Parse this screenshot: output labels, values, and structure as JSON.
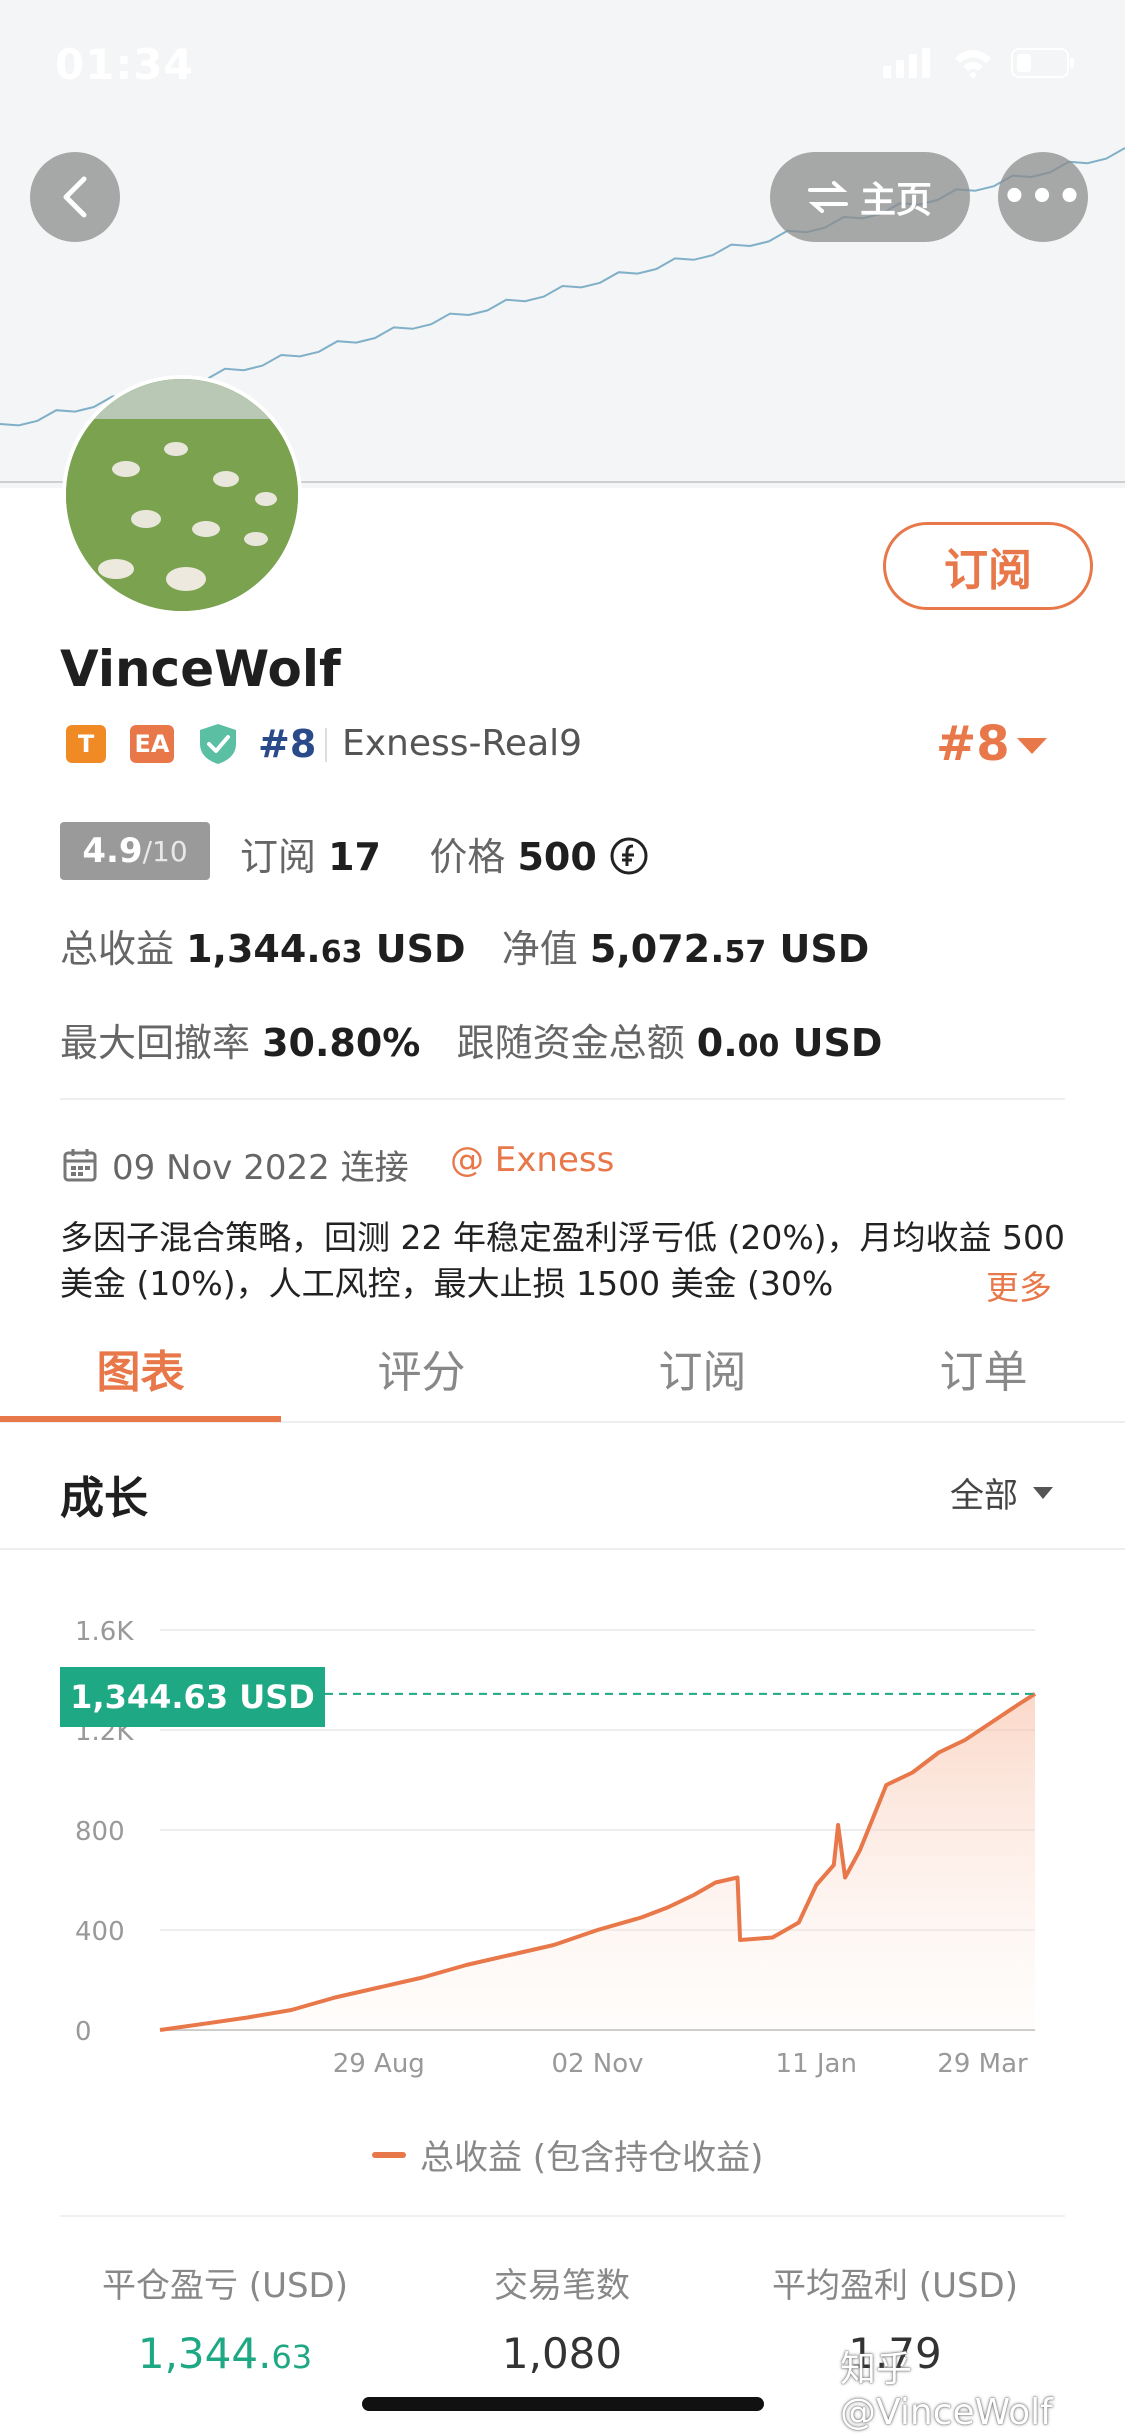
{
  "status_bar": {
    "time": "01:34"
  },
  "header": {
    "home_label": "主页",
    "more_label": "•••"
  },
  "profile": {
    "subscribe_label": "订阅",
    "username": "VinceWolf",
    "tags": {
      "t": "T",
      "ea": "EA"
    },
    "rank_small": "#8",
    "server": "Exness-Real9",
    "rank_big": "#8",
    "rating": {
      "score": "4.9",
      "denom": "/10"
    },
    "subscribers_label": "订阅",
    "subscribers_value": "17",
    "price_label": "价格",
    "price_value": "500",
    "total_profit_label": "总收益",
    "total_profit_int": "1,344.",
    "total_profit_dec": "63",
    "total_profit_unit": "USD",
    "equity_label": "净值",
    "equity_int": "5,072.",
    "equity_dec": "57",
    "equity_unit": "USD",
    "max_dd_label": "最大回撤率",
    "max_dd_value": "30.80%",
    "follow_label": "跟随资金总额",
    "follow_int": "0.",
    "follow_dec": "00",
    "follow_unit": "USD",
    "date_text": "09 Nov 2022 连接",
    "broker": "@ Exness",
    "description": "多因子混合策略，回测 22 年稳定盈利浮亏低 (20%)，月均收益 500 美金 (10%)，人工风控，最大止损 1500 美金 (30%",
    "more_label": "更多"
  },
  "tabs": [
    "图表",
    "评分",
    "订阅",
    "订单"
  ],
  "growth": {
    "title": "成长",
    "range": "全部",
    "current_label": "1,344.63 USD",
    "legend": "总收益 (包含持仓收益)"
  },
  "chart_data": {
    "type": "area",
    "title": "",
    "xlabel": "",
    "ylabel": "",
    "ylim": [
      0,
      1600
    ],
    "yticks": [
      "0",
      "400",
      "800",
      "1.2K",
      "1.6K"
    ],
    "xticks": [
      "29 Aug",
      "02 Nov",
      "11 Jan",
      "29 Mar"
    ],
    "series": [
      {
        "name": "总收益 (包含持仓收益)",
        "color": "#e8784a",
        "points": [
          [
            0,
            0
          ],
          [
            0.05,
            25
          ],
          [
            0.1,
            50
          ],
          [
            0.15,
            80
          ],
          [
            0.2,
            130
          ],
          [
            0.25,
            170
          ],
          [
            0.3,
            210
          ],
          [
            0.35,
            260
          ],
          [
            0.4,
            300
          ],
          [
            0.45,
            340
          ],
          [
            0.5,
            400
          ],
          [
            0.55,
            450
          ],
          [
            0.58,
            490
          ],
          [
            0.61,
            540
          ],
          [
            0.635,
            590
          ],
          [
            0.66,
            610
          ],
          [
            0.663,
            360
          ],
          [
            0.7,
            370
          ],
          [
            0.73,
            430
          ],
          [
            0.75,
            580
          ],
          [
            0.77,
            660
          ],
          [
            0.775,
            820
          ],
          [
            0.783,
            610
          ],
          [
            0.8,
            720
          ],
          [
            0.83,
            980
          ],
          [
            0.86,
            1030
          ],
          [
            0.89,
            1110
          ],
          [
            0.92,
            1160
          ],
          [
            0.95,
            1230
          ],
          [
            0.98,
            1300
          ],
          [
            1.0,
            1344.63
          ]
        ]
      }
    ]
  },
  "stats": [
    {
      "label": "平仓盈亏 (USD)",
      "value_int": "1,344.",
      "value_dec": "63"
    },
    {
      "label": "交易笔数",
      "value_int": "1,080",
      "value_dec": ""
    },
    {
      "label": "平均盈利 (USD)",
      "value_int": "1.79",
      "value_dec": ""
    }
  ],
  "watermark": "知乎 @VinceWolf",
  "colors": {
    "accent": "#e8784a",
    "green": "#1fa884",
    "navy": "#2b4a8a"
  }
}
